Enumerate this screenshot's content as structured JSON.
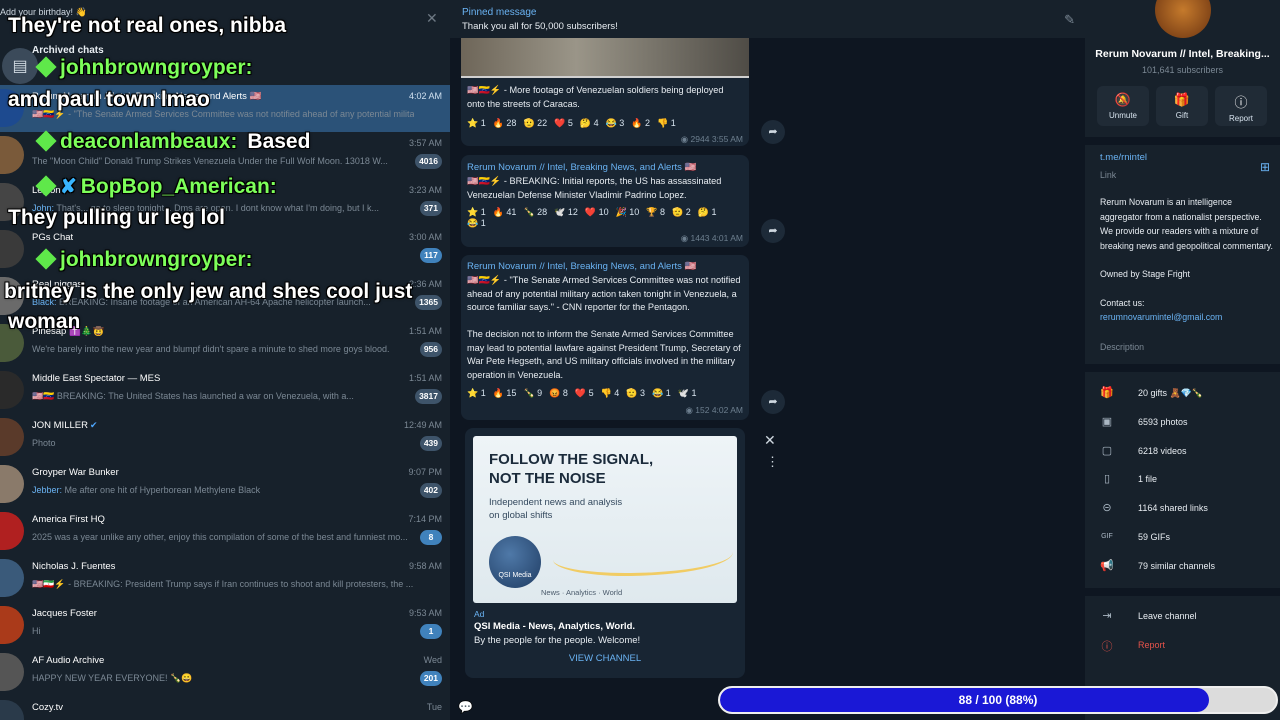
{
  "left": {
    "birthday_note": "Add your birthday! 👋",
    "archived_title": "Archived chats",
    "chats": [
      {
        "name": "Rerum Novarum // Intel, Breaking News, and Alerts 🇺🇸",
        "time": "4:02 AM",
        "preview": "🇺🇸🇻🇪⚡ - \"The Senate Armed Services Committee was not notified ahead of any potential military a...",
        "badge": "",
        "selected": true
      },
      {
        "name": "",
        "time": "3:57 AM",
        "preview": "The \"Moon Child\" Donald Trump Strikes Venezuela Under the Full Wolf Moon. 13018 W...",
        "badge": "4016",
        "selected": false
      },
      {
        "name": "Legion",
        "time": "3:23 AM",
        "preview_sender": "John:",
        "preview": "That's... go to sleep tonight... Dms are open. I dont know what I'm doing, but I k...",
        "badge": "371",
        "selected": false
      },
      {
        "name": "PGs Chat",
        "time": "3:00 AM",
        "preview": "",
        "badge": "117",
        "selected": false,
        "badge_blue": true
      },
      {
        "name": "Real niggas",
        "time": "2:36 AM",
        "preview_sender": "Black:",
        "preview": "BREAKING: Insane footage of an American AH-64 Apache helicopter launch...",
        "badge": "1365",
        "selected": false
      },
      {
        "name": "Pinesap ✝️🎄🤠",
        "time": "1:51 AM",
        "preview": "We're barely into the new year and blumpf didn't spare a minute to shed more goys blood.",
        "badge": "956",
        "selected": false
      },
      {
        "name": "Middle East Spectator — MES",
        "time": "1:51 AM",
        "preview": "🇺🇸🇻🇪 BREAKING: The United States has launched a war on Venezuela, with a...",
        "badge": "3817",
        "selected": false
      },
      {
        "name": "JON MILLER",
        "time": "12:49 AM",
        "preview": "Photo",
        "badge": "439",
        "selected": false,
        "verified": true
      },
      {
        "name": "Groyper War Bunker",
        "time": "9:07 PM",
        "preview_sender": "Jebber:",
        "preview": "Me after one hit of Hyperborean Methylene Black",
        "badge": "402",
        "selected": false
      },
      {
        "name": "America First HQ",
        "time": "7:14 PM",
        "preview": "2025 was a year unlike any other, enjoy this compilation of some of the best and funniest mo...",
        "badge": "8",
        "selected": false,
        "badge_blue": true
      },
      {
        "name": "Nicholas J. Fuentes",
        "time": "9:58 AM",
        "preview": "🇺🇸🇮🇷⚡ - BREAKING: President Trump says if Iran continues to shoot and kill protesters, the ...",
        "badge": "",
        "selected": false
      },
      {
        "name": "Jacques Foster",
        "time": "9:53 AM",
        "preview": "Hi",
        "badge": "1",
        "selected": false,
        "badge_blue": true
      },
      {
        "name": "AF Audio Archive",
        "time": "Wed",
        "preview": "HAPPY NEW YEAR EVERYONE! 🍾😀",
        "badge": "201",
        "selected": false,
        "badge_blue": true
      },
      {
        "name": "Cozy.tv",
        "time": "Tue",
        "preview": "",
        "badge": "",
        "selected": false
      }
    ]
  },
  "overlay": [
    {
      "kind": "w",
      "text": "They're not real ones, nibba"
    },
    {
      "kind": "g",
      "text": "johnbrowngroyper:"
    },
    {
      "kind": "w",
      "text": "amd paul town lmao"
    },
    {
      "kind": "g",
      "text": "deaconlambeaux:",
      "extra": "Based"
    },
    {
      "kind": "g",
      "text": "BopBop_American:",
      "blue": true
    },
    {
      "kind": "w",
      "text": "They pulling ur leg lol"
    },
    {
      "kind": "g",
      "text": "johnbrowngroyper:"
    },
    {
      "kind": "w",
      "text": "britney is the only jew and shes cool just"
    },
    {
      "kind": "w",
      "text": "woman"
    }
  ],
  "center": {
    "pinned_label": "Pinned message",
    "pinned_text": "Thank you all for 50,000 subscribers!",
    "messages": [
      {
        "sender": "",
        "text": "🇺🇸🇻🇪⚡ - More footage of Venezuelan soldiers being deployed onto the streets of Caracas.",
        "reactions": [
          "⭐ 1",
          "🔥 28",
          "🫡 22",
          "❤️ 5",
          "🤔 4",
          "😂 3",
          "🔥 2",
          "👎 1"
        ],
        "views": "2944",
        "time": "3:55 AM"
      },
      {
        "sender": "Rerum Novarum // Intel, Breaking News, and Alerts 🇺🇸",
        "text": "🇺🇸🇻🇪⚡ - BREAKING: Initial reports, the US has assassinated Venezuelan Defense Minister Vladimir Padrino Lopez.",
        "reactions": [
          "⭐ 1",
          "🔥 41",
          "🍾 28",
          "🕊️ 12",
          "❤️ 10",
          "🎉 10",
          "🏆 8",
          "🫡 2",
          "🤔 1",
          "😂 1"
        ],
        "views": "1443",
        "time": "4:01 AM"
      },
      {
        "sender": "Rerum Novarum // Intel, Breaking News, and Alerts 🇺🇸",
        "text": "🇺🇸🇻🇪⚡ - \"The Senate Armed Services Committee was not notified ahead of any potential military action taken tonight in Venezuela, a source familiar says.\" - CNN reporter for the Pentagon.",
        "text2": "The decision not to inform the Senate Armed Services Committee may lead to potential lawfare against President Trump, Secretary of War Pete Hegseth, and US military officials involved in the military operation in Venezuela.",
        "reactions": [
          "⭐ 1",
          "🔥 15",
          "🍾 9",
          "😡 8",
          "❤️ 5",
          "👎 4",
          "🫡 3",
          "😂 1",
          "🕊️ 1"
        ],
        "views": "152",
        "time": "4:02 AM"
      }
    ],
    "ad": {
      "headline": "FOLLOW THE SIGNAL, NOT THE NOISE",
      "subline": "Independent news and analysis on global shifts",
      "logo_text": "QSI Media",
      "footer": "News · Analytics · World",
      "label": "Ad",
      "title": "QSI Media - News, Analytics, World.",
      "desc": "By the people for the people. Welcome!",
      "button": "VIEW CHANNEL"
    }
  },
  "right": {
    "channel_name": "Rerum Novarum // Intel, Breaking...",
    "subscribers": "101,641 subscribers",
    "actions": [
      {
        "icon": "🔕",
        "label": "Unmute"
      },
      {
        "icon": "🎁",
        "label": "Gift"
      },
      {
        "icon": "ⓘ",
        "label": "Report"
      }
    ],
    "link": "t.me/rnintel",
    "link_label": "Link",
    "description": "Rerum Novarum is an intelligence aggregator from a nationalist perspective. We provide our readers with a mixture of breaking news and geopolitical commentary.",
    "owned": "Owned by Stage Fright",
    "contact": "Contact us:",
    "email": "rerumnovarumintel@gmail.com",
    "desc_label": "Description",
    "media": [
      {
        "icon": "🎁",
        "text": "20 gifts 🧸💎🍾"
      },
      {
        "icon": "▣",
        "text": "6593 photos"
      },
      {
        "icon": "▢",
        "text": "6218 videos"
      },
      {
        "icon": "▯",
        "text": "1 file"
      },
      {
        "icon": "⊝",
        "text": "1164 shared links"
      },
      {
        "icon": "GIF",
        "text": "59 GIFs"
      },
      {
        "icon": "📢",
        "text": "79 similar channels"
      }
    ],
    "leave": "Leave channel",
    "report": "Report"
  },
  "progress": {
    "label": "88 / 100 (88%)",
    "value": 0.88
  }
}
